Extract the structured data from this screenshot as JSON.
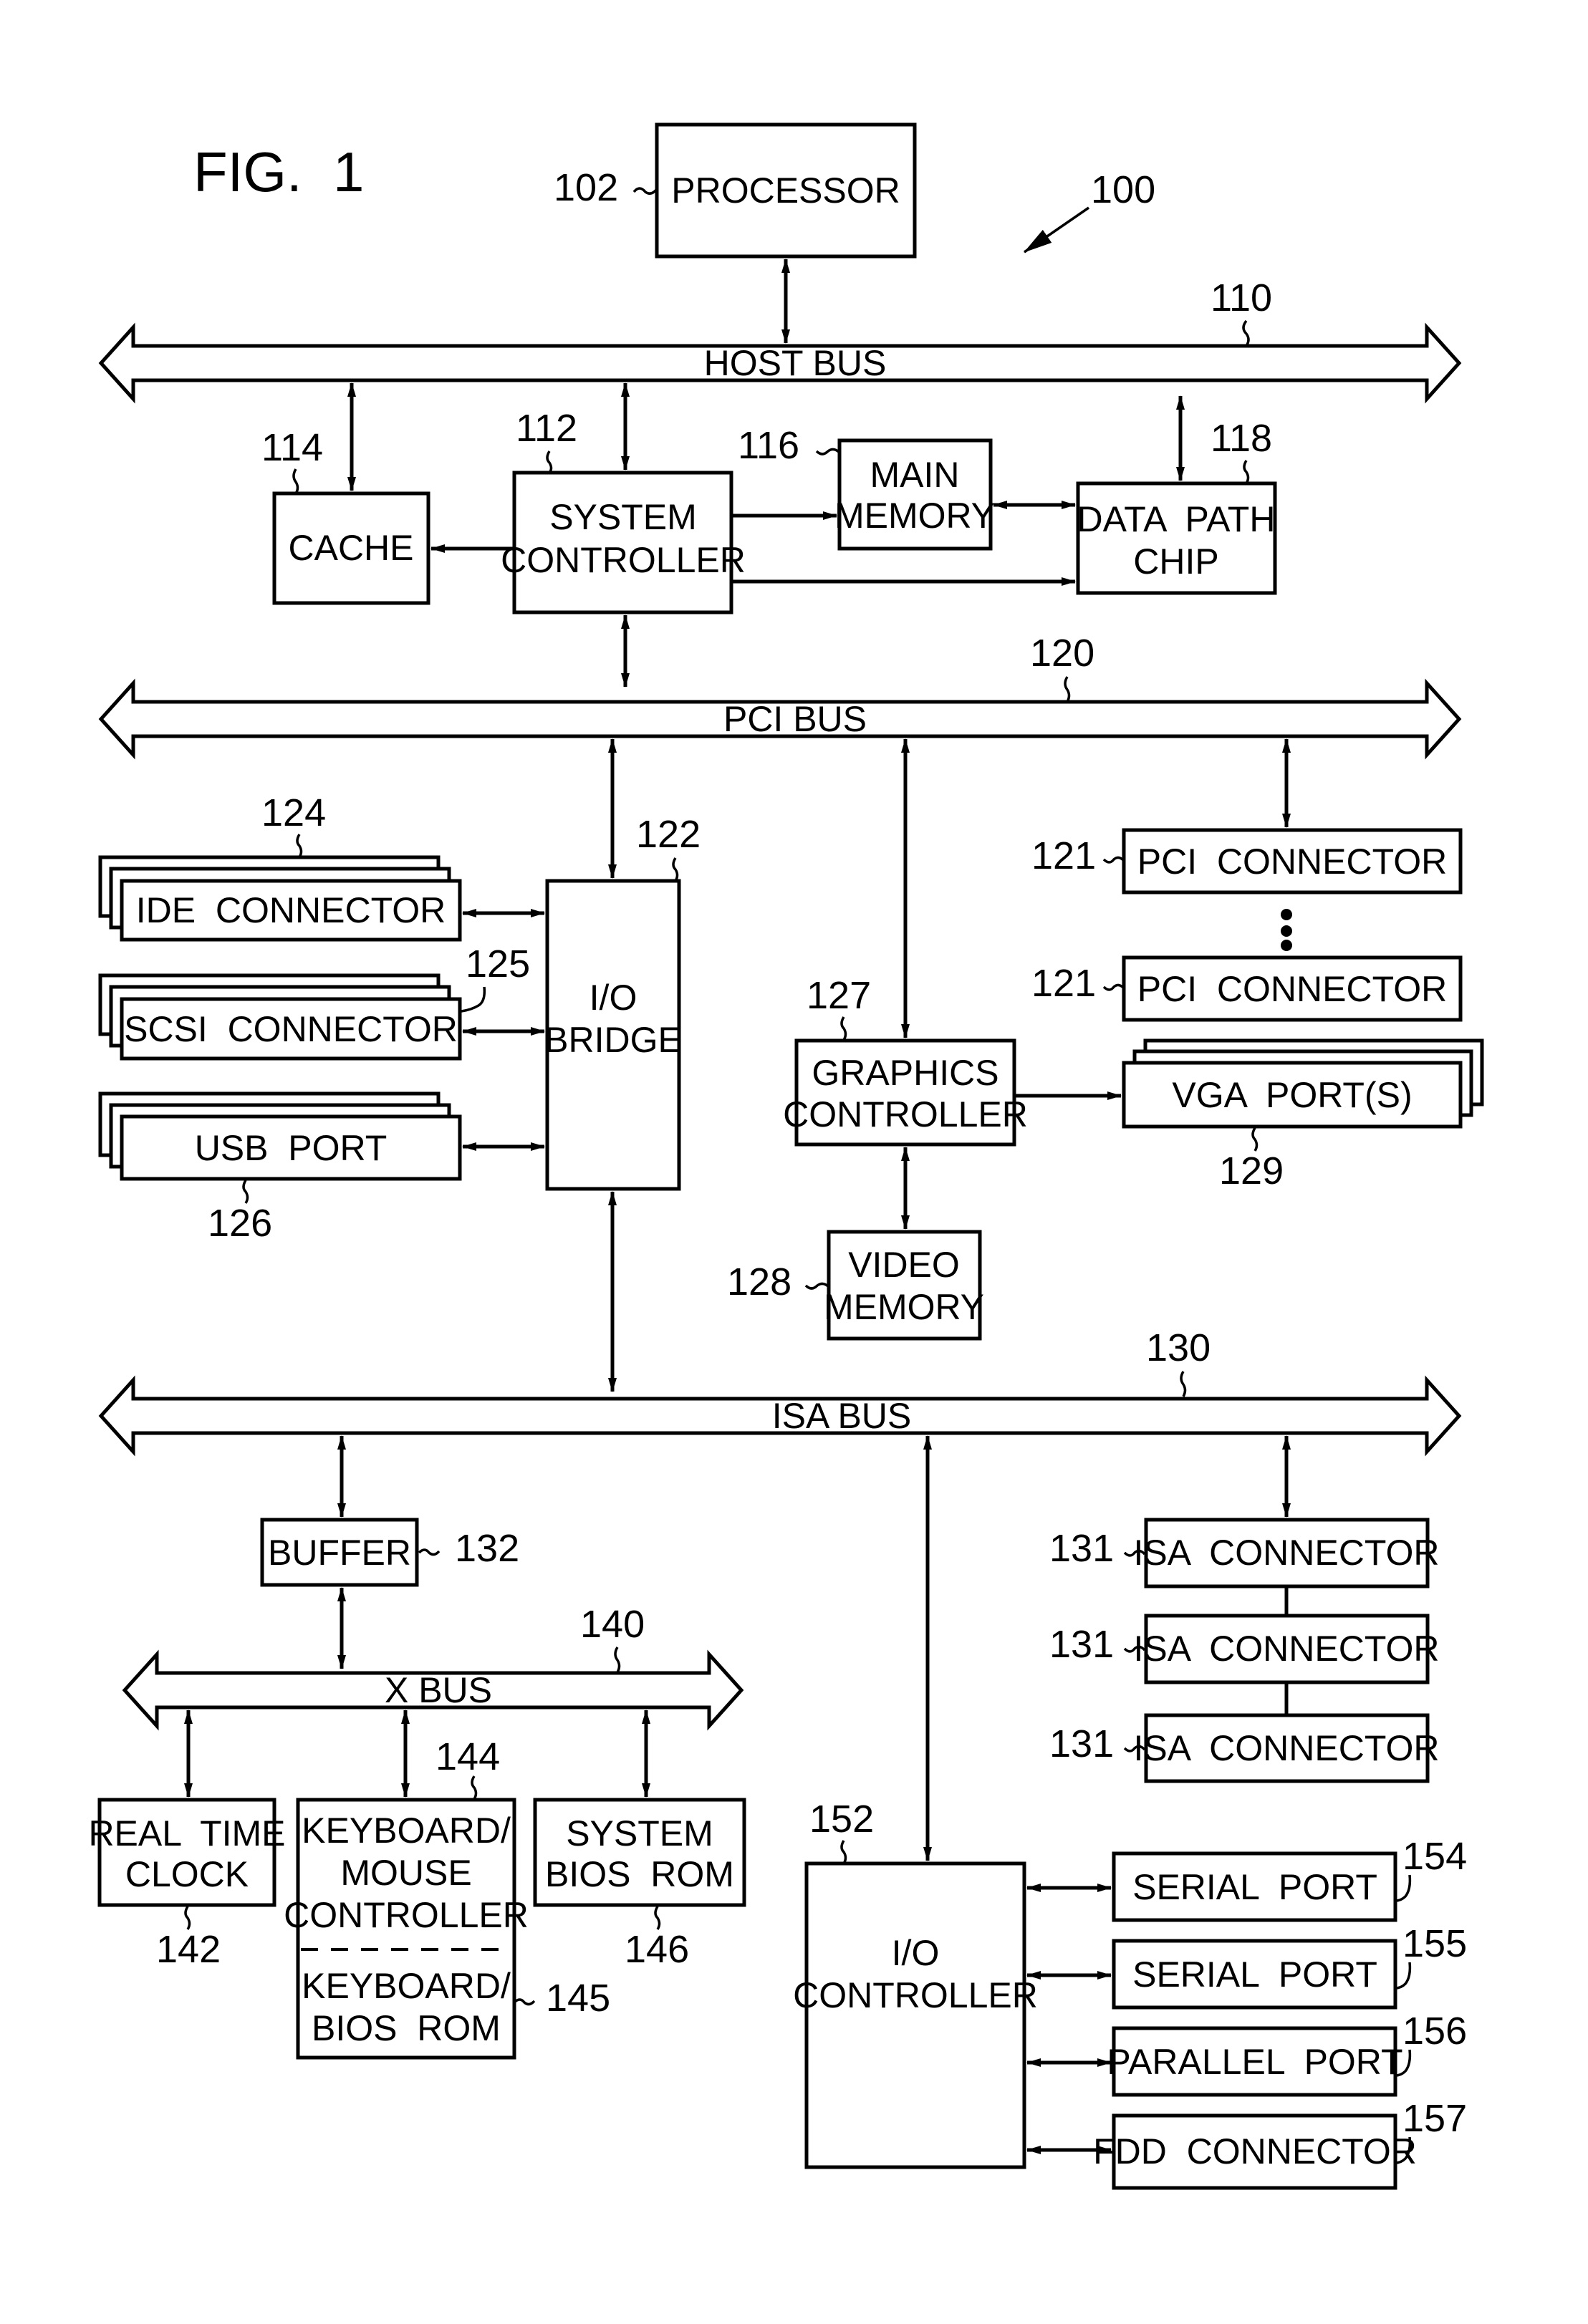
{
  "figure": {
    "title": "FIG.  1",
    "system_ref": "100"
  },
  "buses": {
    "host": {
      "label": "HOST BUS",
      "ref": "110"
    },
    "pci": {
      "label": "PCI BUS",
      "ref": "120"
    },
    "isa": {
      "label": "ISA BUS",
      "ref": "130"
    },
    "x": {
      "label": "X BUS",
      "ref": "140"
    }
  },
  "blocks": {
    "processor": {
      "lines": [
        "PROCESSOR"
      ],
      "ref": "102"
    },
    "cache": {
      "lines": [
        "CACHE"
      ],
      "ref": "114"
    },
    "system_controller": {
      "lines": [
        "SYSTEM",
        "CONTROLLER"
      ],
      "ref": "112"
    },
    "main_memory": {
      "lines": [
        "MAIN",
        "MEMORY"
      ],
      "ref": "116"
    },
    "data_path_chip": {
      "lines": [
        "DATA  PATH",
        "CHIP"
      ],
      "ref": "118"
    },
    "io_bridge": {
      "lines": [
        "I/O",
        "BRIDGE"
      ],
      "ref": "122"
    },
    "ide_connector": {
      "lines": [
        "IDE  CONNECTOR"
      ],
      "ref": "124"
    },
    "scsi_connector": {
      "lines": [
        "SCSI  CONNECTOR"
      ],
      "ref": "125"
    },
    "usb_port": {
      "lines": [
        "USB  PORT"
      ],
      "ref": "126"
    },
    "pci_connector_1": {
      "lines": [
        "PCI  CONNECTOR"
      ],
      "ref": "121"
    },
    "pci_connector_2": {
      "lines": [
        "PCI  CONNECTOR"
      ],
      "ref": "121"
    },
    "graphics_controller": {
      "lines": [
        "GRAPHICS",
        "CONTROLLER"
      ],
      "ref": "127"
    },
    "vga_ports": {
      "lines": [
        "VGA  PORT(S)"
      ],
      "ref": "129"
    },
    "video_memory": {
      "lines": [
        "VIDEO",
        "MEMORY"
      ],
      "ref": "128"
    },
    "buffer": {
      "lines": [
        "BUFFER"
      ],
      "ref": "132"
    },
    "real_time_clock": {
      "lines": [
        "REAL  TIME",
        "CLOCK"
      ],
      "ref": "142"
    },
    "keyboard_mouse_controller": {
      "lines": [
        "KEYBOARD/",
        "MOUSE",
        "CONTROLLER"
      ],
      "ref": "144"
    },
    "keyboard_bios_rom": {
      "lines": [
        "KEYBOARD/",
        "BIOS  ROM"
      ],
      "ref": "145"
    },
    "system_bios_rom": {
      "lines": [
        "SYSTEM",
        "BIOS  ROM"
      ],
      "ref": "146"
    },
    "isa_connector_1": {
      "lines": [
        "ISA  CONNECTOR"
      ],
      "ref": "131"
    },
    "isa_connector_2": {
      "lines": [
        "ISA  CONNECTOR"
      ],
      "ref": "131"
    },
    "isa_connector_3": {
      "lines": [
        "ISA  CONNECTOR"
      ],
      "ref": "131"
    },
    "io_controller": {
      "lines": [
        "I/O",
        "CONTROLLER"
      ],
      "ref": "152"
    },
    "serial_port_1": {
      "lines": [
        "SERIAL  PORT"
      ],
      "ref": "154"
    },
    "serial_port_2": {
      "lines": [
        "SERIAL  PORT"
      ],
      "ref": "155"
    },
    "parallel_port": {
      "lines": [
        "PARALLEL  PORT"
      ],
      "ref": "156"
    },
    "fdd_connector": {
      "lines": [
        "FDD  CONNECTOR"
      ],
      "ref": "157"
    }
  }
}
